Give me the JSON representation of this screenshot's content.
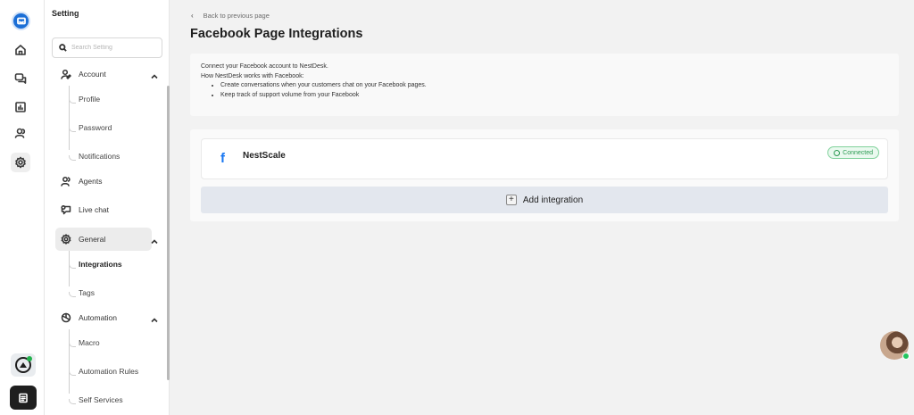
{
  "sidebar": {
    "title": "Setting",
    "search_placeholder": "Search Setting",
    "groups": [
      {
        "label": "Account",
        "items": [
          "Profile",
          "Password",
          "Notifications"
        ]
      },
      {
        "label": "Agents"
      },
      {
        "label": "Live chat"
      },
      {
        "label": "General",
        "items": [
          "Integrations",
          "Tags"
        ]
      },
      {
        "label": "Automation",
        "items": [
          "Macro",
          "Automation Rules",
          "Self Services"
        ]
      }
    ]
  },
  "main": {
    "back_label": "Back to previous page",
    "title": "Facebook Page Integrations",
    "info": {
      "intro": "Connect your Facebook account to NestDesk.",
      "how": "How NestDesk works with Facebook:",
      "bullets": [
        "Create conversations when your customers chat on your Facebook pages.",
        "Keep track of support volume from your Facebook"
      ]
    },
    "integration": {
      "icon": "facebook-icon",
      "fb_glyph": "f",
      "name": "NestScale",
      "status": "Connected"
    },
    "add_label": "Add integration"
  },
  "colors": {
    "brand": "#1c6fd6",
    "facebook": "#1877f2",
    "connected": "#2b9a52",
    "add_bar": "#e3e7ee"
  }
}
